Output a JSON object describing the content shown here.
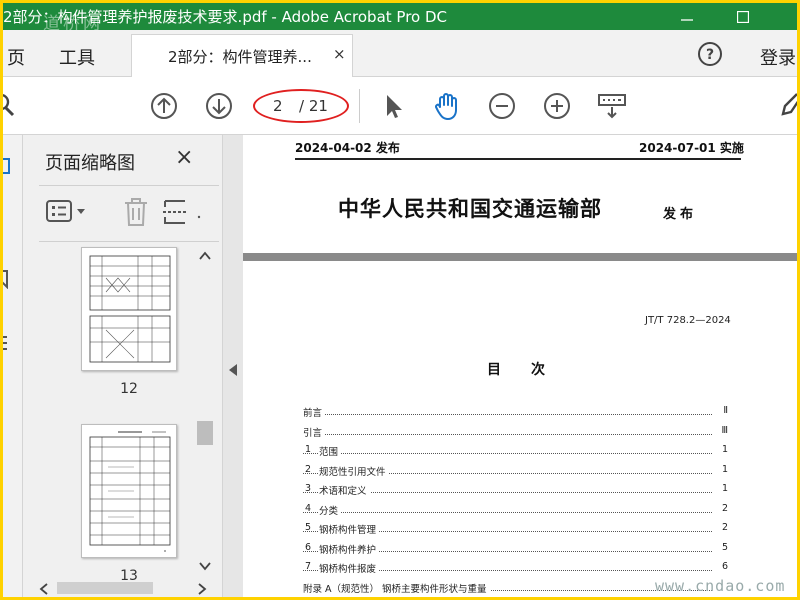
{
  "window": {
    "title": "2部分：构件管理养护报废技术要求.pdf - Adobe Acrobat Pro DC",
    "watermark_top": "道桥网"
  },
  "menu": {
    "home": "页",
    "tools": "工具",
    "login": "登录"
  },
  "tab": {
    "label": "2部分：构件管理养...",
    "close": "×"
  },
  "toolbar": {
    "current_page": "2",
    "total_pages": "/ 21"
  },
  "thumbnails": {
    "title": "页面缩略图",
    "close": "×",
    "pages": [
      {
        "label": "12"
      },
      {
        "label": "13"
      }
    ]
  },
  "document": {
    "publish_date": "2024-04-02 发布",
    "implement_date": "2024-07-01 实施",
    "ministry": "中华人民共和国交通运输部",
    "issue_label": "发布",
    "standard_no": "JT/T 728.2—2024",
    "toc_title": "目次",
    "toc": [
      {
        "num": "",
        "text": "前言",
        "page": "Ⅱ"
      },
      {
        "num": "",
        "text": "引言",
        "page": "Ⅲ"
      },
      {
        "num": "1",
        "text": "范围",
        "page": "1"
      },
      {
        "num": "2",
        "text": "规范性引用文件",
        "page": "1"
      },
      {
        "num": "3",
        "text": "术语和定义",
        "page": "1"
      },
      {
        "num": "4",
        "text": "分类",
        "page": "2"
      },
      {
        "num": "5",
        "text": "钢桥构件管理",
        "page": "2"
      },
      {
        "num": "6",
        "text": "钢桥构件养护",
        "page": "5"
      },
      {
        "num": "7",
        "text": "钢桥构件报废",
        "page": "6"
      },
      {
        "num": "",
        "text": "附录 A（规范性）  钢桥主要构件形状与重量",
        "page": ""
      }
    ]
  },
  "bottom_watermark": "www.cndao.com"
}
